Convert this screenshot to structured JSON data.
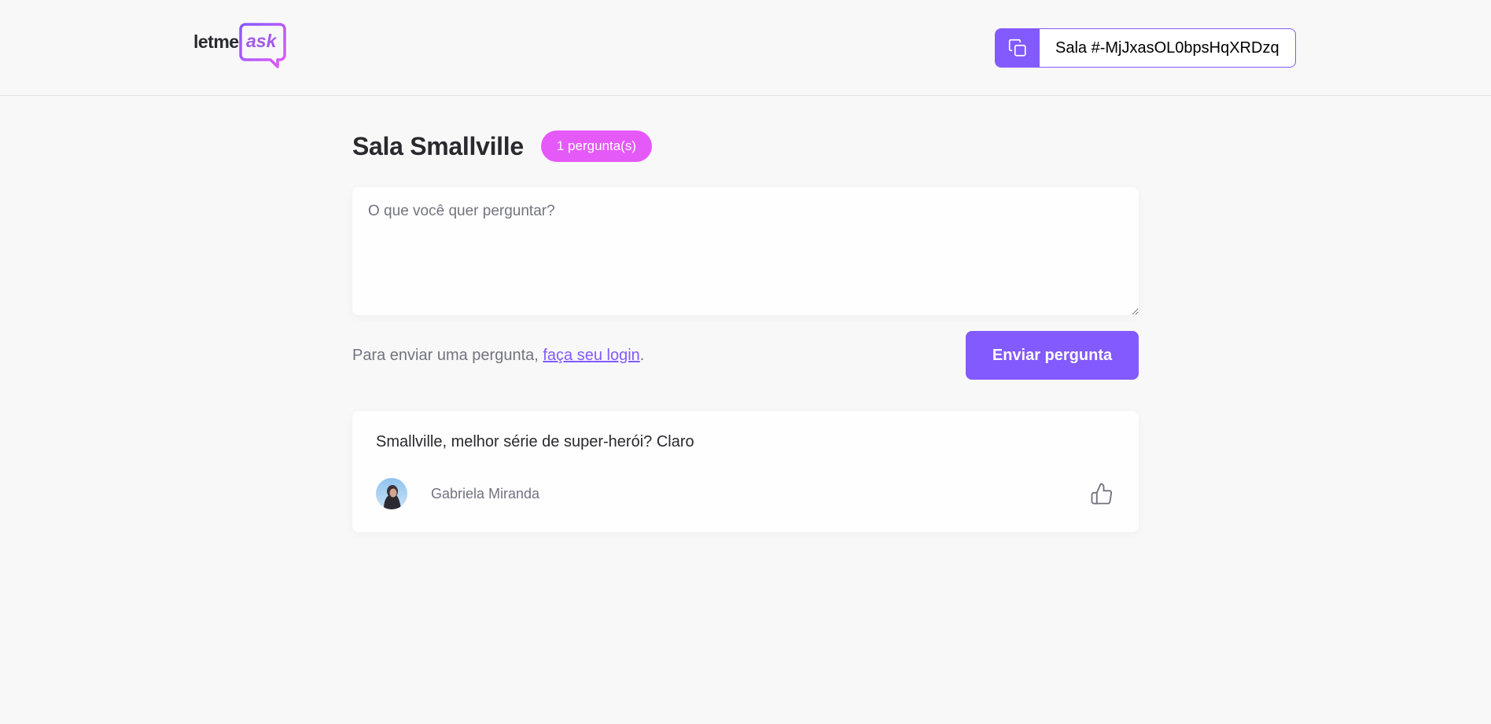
{
  "header": {
    "logo_left": "letme",
    "logo_right": "ask",
    "room_code_label": "Sala #-MjJxasOL0bpsHqXRDzq"
  },
  "room": {
    "title": "Sala Smallville",
    "question_count_badge": "1 pergunta(s)"
  },
  "form": {
    "placeholder": "O que você quer perguntar?",
    "value": "",
    "login_hint_prefix": "Para enviar uma pergunta, ",
    "login_link": "faça seu login",
    "login_hint_suffix": ".",
    "submit_label": "Enviar pergunta"
  },
  "questions": [
    {
      "content": "Smallville, melhor série de super-herói? Claro",
      "author_name": "Gabriela Miranda",
      "avatar_icon": "user-avatar",
      "like_icon": "thumbs-up-icon"
    }
  ],
  "colors": {
    "primary": "#835afd",
    "badge": "#e559f9",
    "logo_accent": "#a35ae8",
    "background": "#f8f8f8",
    "text": "#29292e",
    "muted": "#737380"
  }
}
